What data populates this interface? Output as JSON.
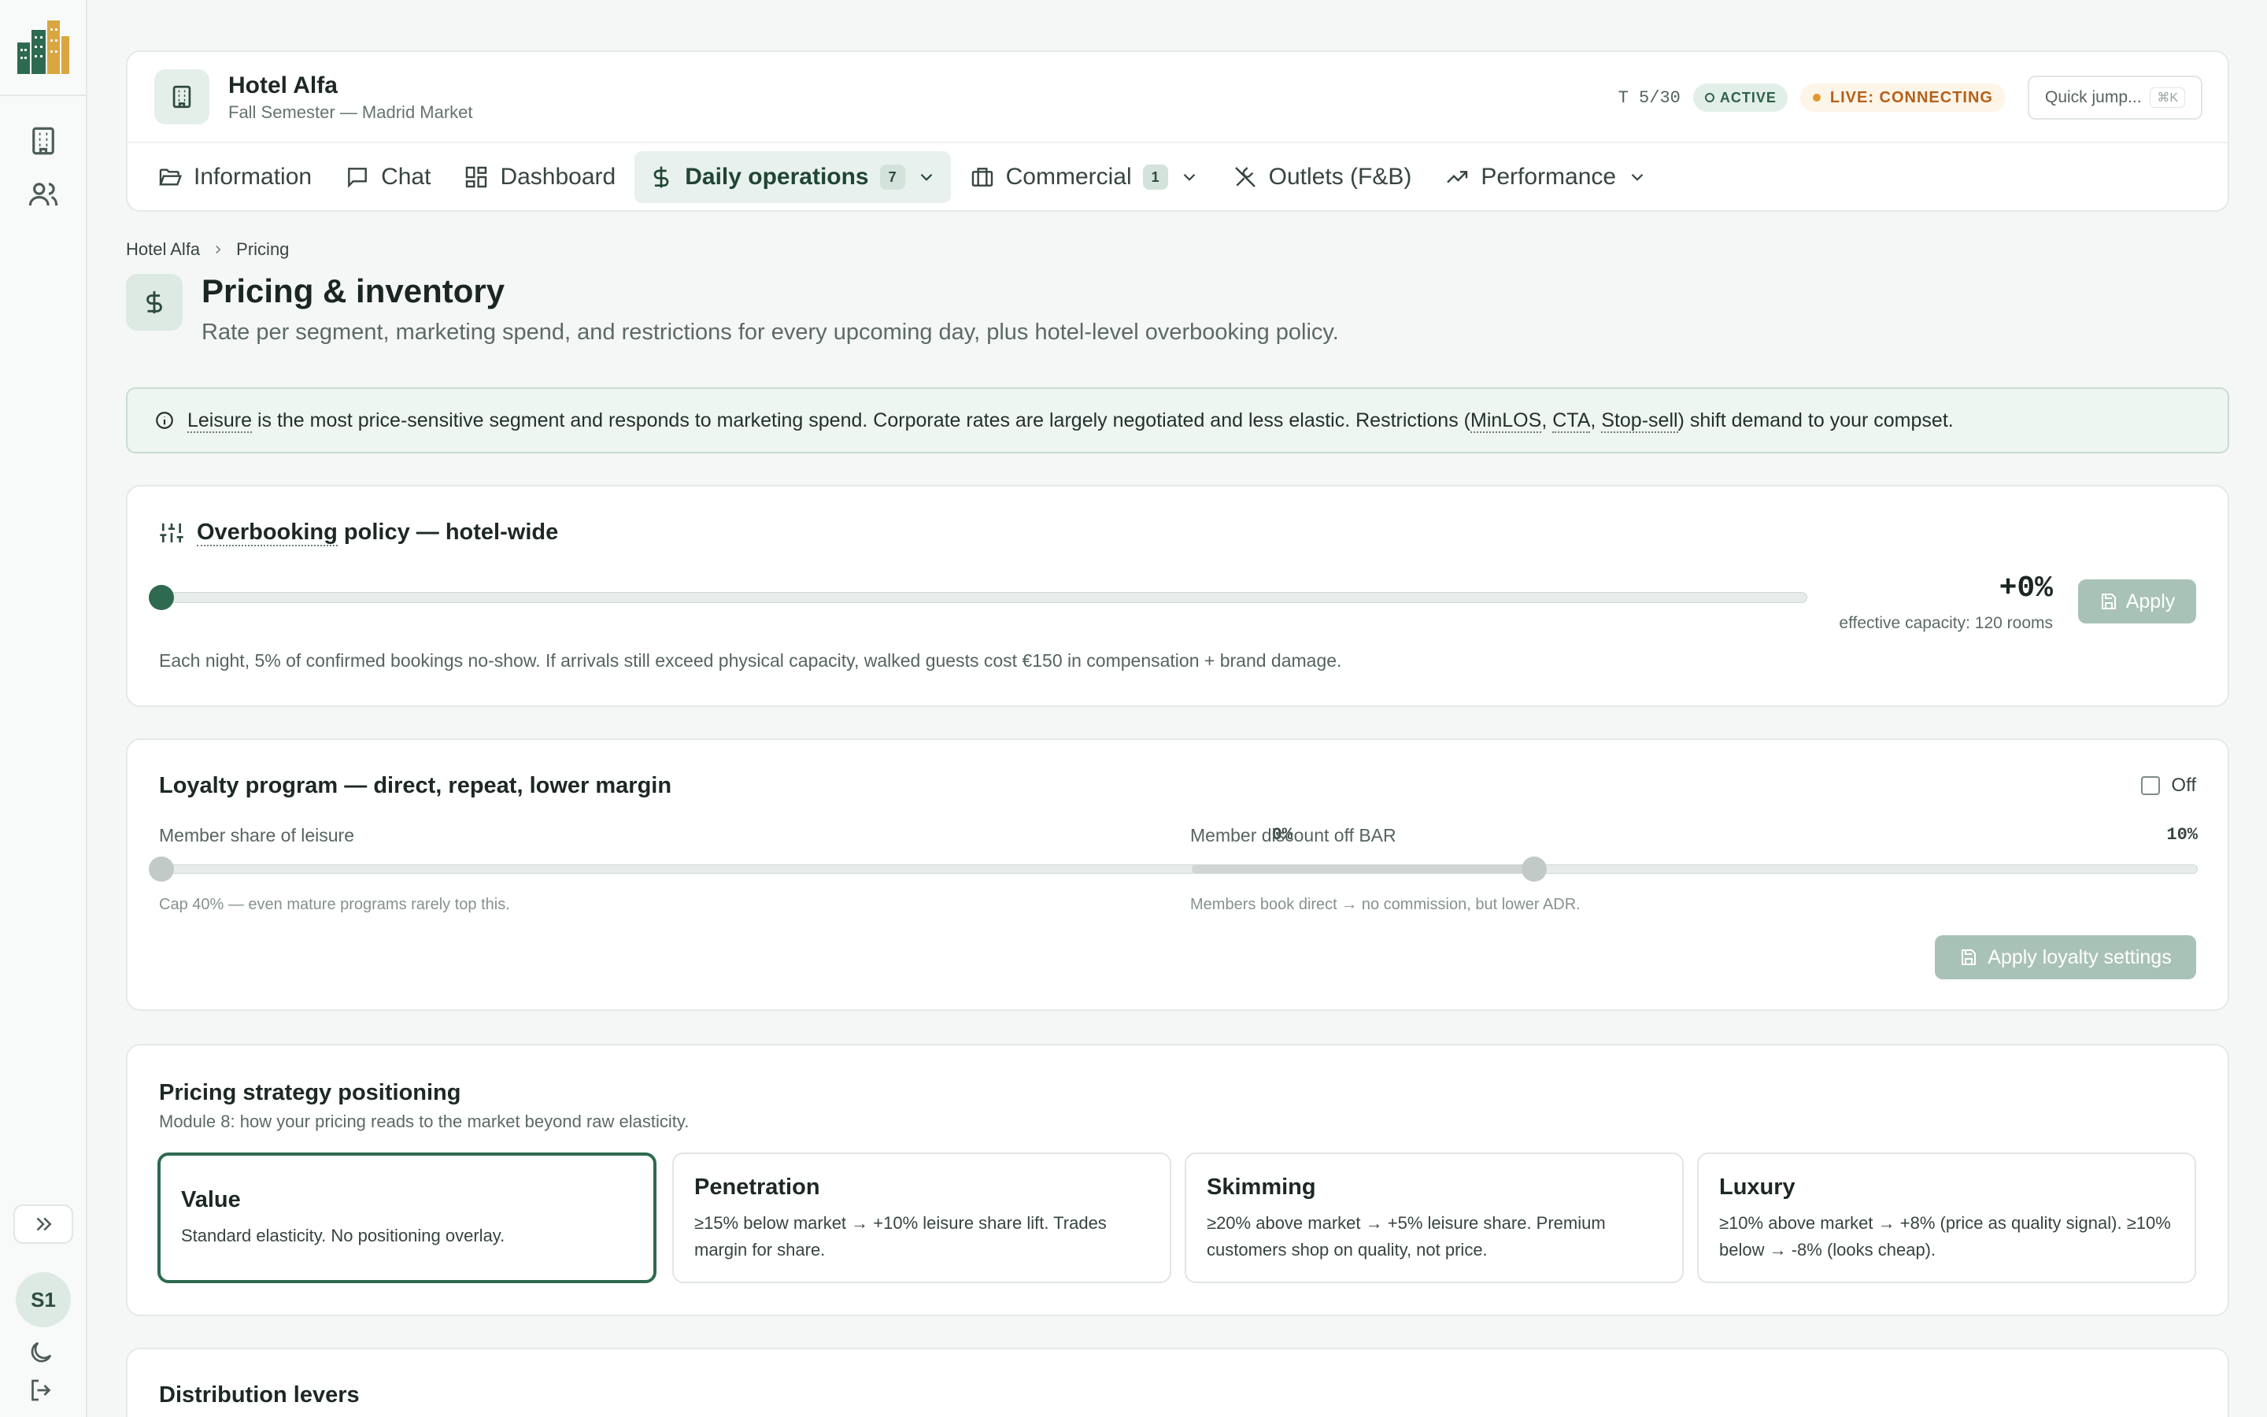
{
  "rail": {
    "avatar_initials": "S1"
  },
  "header": {
    "hotel_name": "Hotel Alfa",
    "hotel_subtitle": "Fall Semester — Madrid Market",
    "turn": "T 5/30",
    "status_badge": "ACTIVE",
    "live_status": "LIVE: CONNECTING",
    "quick_jump_placeholder": "Quick jump...",
    "quick_jump_shortcut": "⌘K"
  },
  "tabs": [
    {
      "label": "Information",
      "icon": "folder-icon"
    },
    {
      "label": "Chat",
      "icon": "chat-icon"
    },
    {
      "label": "Dashboard",
      "icon": "dashboard-icon"
    },
    {
      "label": "Daily operations",
      "icon": "dollar-icon",
      "count": "7",
      "active": true
    },
    {
      "label": "Commercial",
      "icon": "briefcase-icon",
      "count": "1"
    },
    {
      "label": "Outlets (F&B)",
      "icon": "utensils-icon"
    },
    {
      "label": "Performance",
      "icon": "trending-up-icon"
    }
  ],
  "breadcrumb": {
    "root": "Hotel Alfa",
    "current": "Pricing"
  },
  "page": {
    "title": "Pricing & inventory",
    "subtitle": "Rate per segment, marketing spend, and restrictions for every upcoming day, plus hotel-level overbooking policy."
  },
  "info_banner": {
    "leisure": "Leisure",
    "text_1": " is the most price-sensitive segment and responds to marketing spend. Corporate rates are largely negotiated and less elastic. Restrictions (",
    "minlos": "MinLOS",
    "sep_1": ", ",
    "cta": "CTA",
    "sep_2": ", ",
    "stopsell": "Stop-sell",
    "text_2": ") shift demand to your compset."
  },
  "overbooking": {
    "title_term": "Overbooking",
    "title_rest": " policy — hotel-wide",
    "value": "+0%",
    "level_fraction": 0,
    "capacity_text": "effective capacity: 120 rooms",
    "apply_label": "Apply",
    "note": "Each night, 5% of confirmed bookings no-show. If arrivals still exceed physical capacity, walked guests cost €150 in compensation + brand damage."
  },
  "loyalty": {
    "title": "Loyalty program — direct, repeat, lower margin",
    "toggle_label": "Off",
    "member_share_label": "Member share of leisure",
    "member_share_value": "0%",
    "member_share_fraction": 0,
    "member_share_help": "Cap 40% — even mature programs rarely top this.",
    "member_discount_label": "Member discount off BAR",
    "member_discount_value": "10%",
    "member_discount_fraction": 0.34,
    "member_discount_help": "Members book direct → no commission, but lower ADR.",
    "apply_label": "Apply loyalty settings"
  },
  "positioning": {
    "title": "Pricing strategy positioning",
    "subtitle": "Module 8: how your pricing reads to the market beyond raw elasticity.",
    "options": [
      {
        "title": "Value",
        "desc": "Standard elasticity. No positioning overlay.",
        "selected": true
      },
      {
        "title": "Penetration",
        "desc": "≥15% below market → +10% leisure share lift. Trades margin for share."
      },
      {
        "title": "Skimming",
        "desc": "≥20% above market → +5% leisure share. Premium customers shop on quality, not price."
      },
      {
        "title": "Luxury",
        "desc": "≥10% above market → +8% (price as quality signal). ≥10% below → -8% (looks cheap)."
      }
    ]
  },
  "distribution": {
    "title": "Distribution levers"
  },
  "colors": {
    "accent": "#2e6a4f",
    "live": "#b4601b",
    "banner_bg": "#eef6f1"
  }
}
